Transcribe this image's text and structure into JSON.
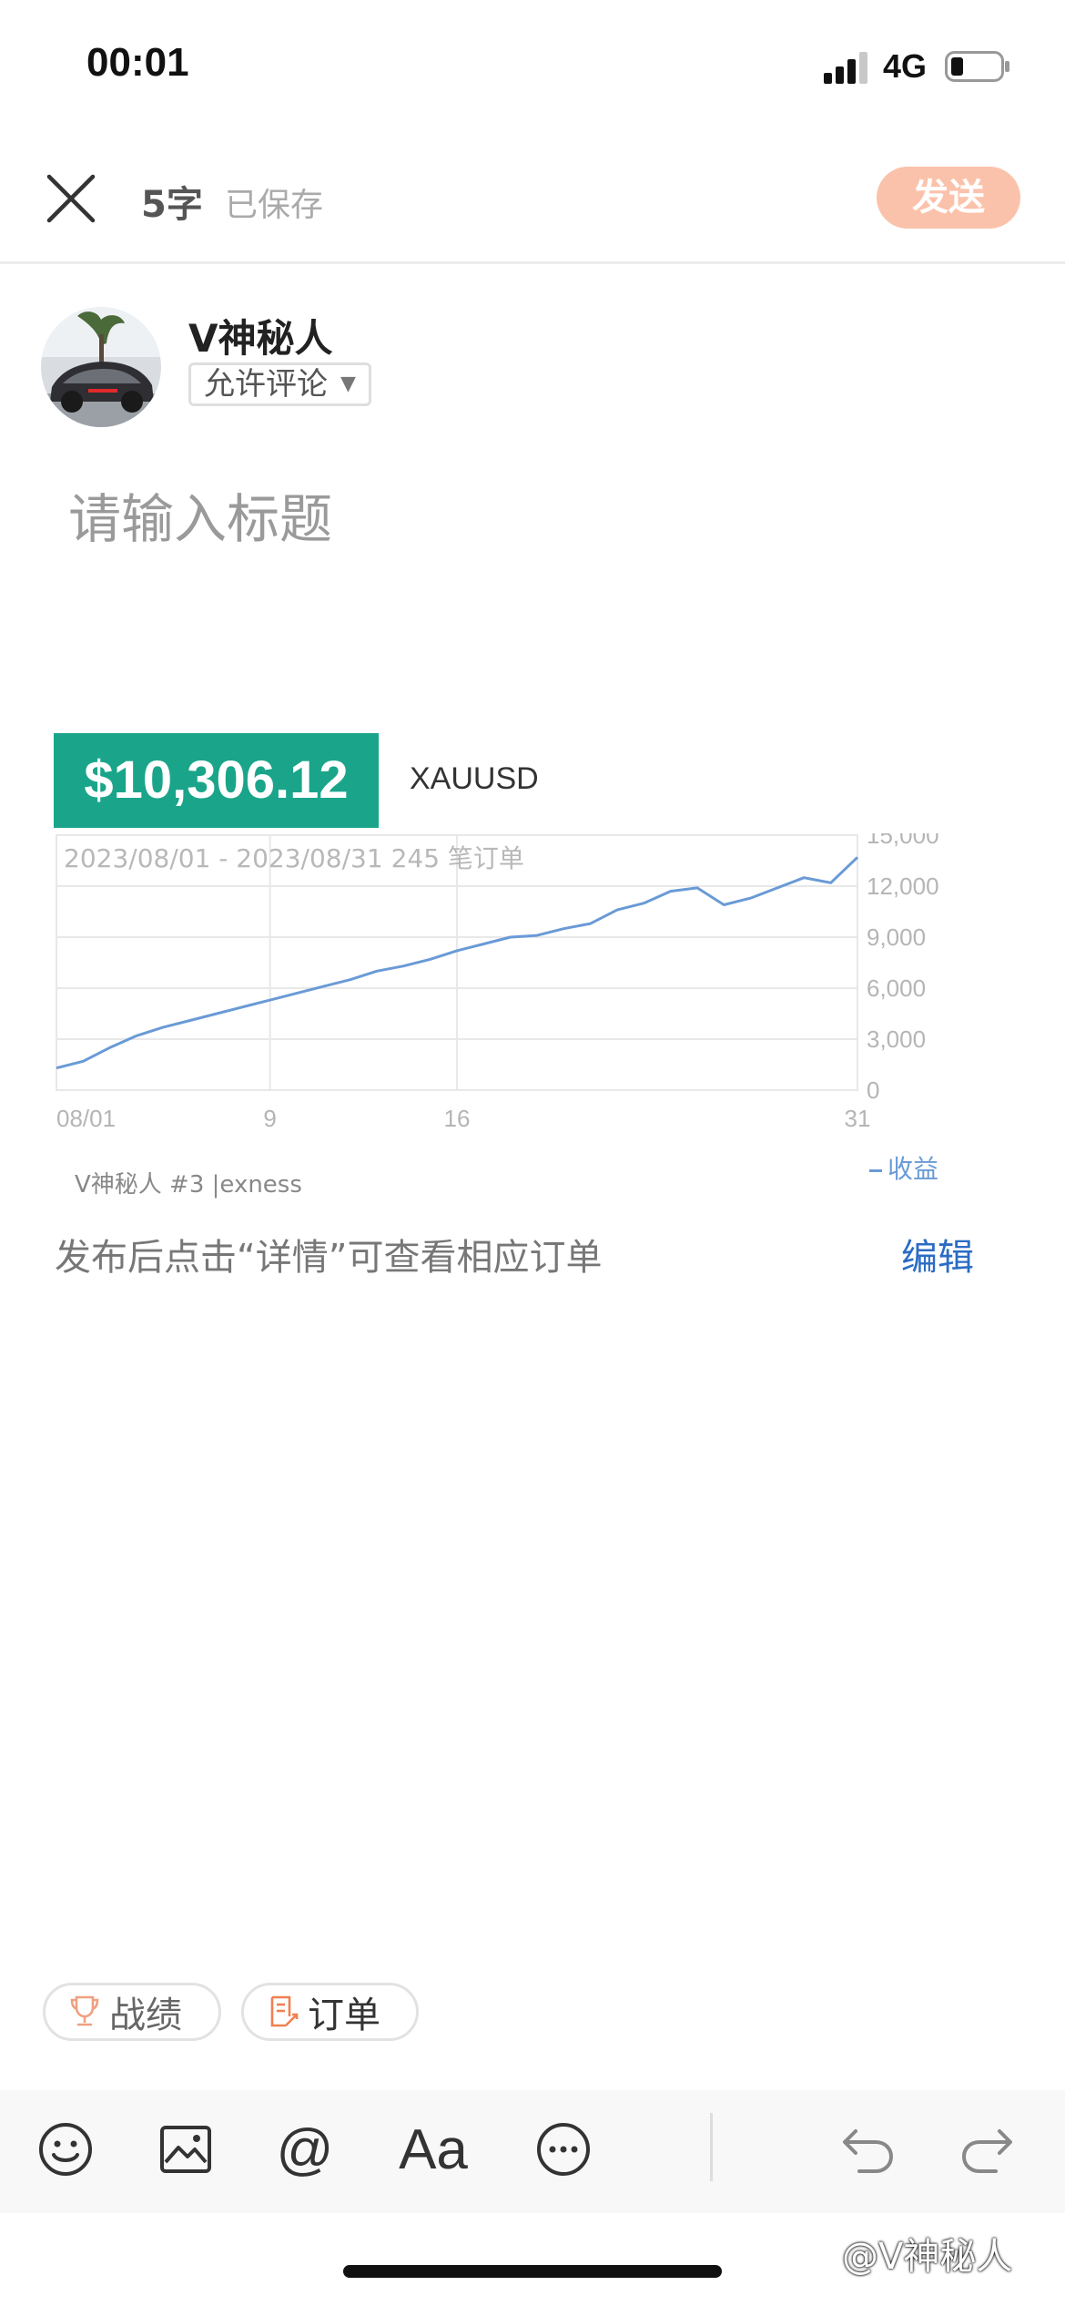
{
  "status_bar": {
    "time": "00:01",
    "network": "4G"
  },
  "header": {
    "word_count": "5字",
    "saved_status": "已保存",
    "send_label": "发送"
  },
  "author": {
    "name": "V神秘人",
    "comment_setting": "允许评论"
  },
  "title_input": {
    "placeholder": "请输入标题",
    "value": ""
  },
  "order_card": {
    "profit": "$10,306.12",
    "symbol": "XAUUSD",
    "footer": "V神秘人 #3 |exness",
    "hint": "发布后点击“详情”可查看相应订单",
    "edit_label": "编辑"
  },
  "chart_data": {
    "type": "line",
    "subtitle": "2023/08/01 - 2023/08/31 245 笔订单",
    "x_ticks": [
      "08/01",
      "9",
      "16",
      "31"
    ],
    "y_ticks": [
      "0",
      "3,000",
      "6,000",
      "9,000",
      "12,000",
      "15,000"
    ],
    "ylim": [
      0,
      15000
    ],
    "xlim": [
      1,
      31
    ],
    "grid": true,
    "legend": "bottom-right",
    "series": [
      {
        "name": "收益",
        "color": "#6a9ad6",
        "x": [
          1,
          2,
          3,
          4,
          5,
          6,
          7,
          8,
          9,
          10,
          11,
          12,
          13,
          14,
          15,
          16,
          17,
          18,
          19,
          20,
          21,
          22,
          23,
          24,
          25,
          26,
          27,
          28,
          29,
          30,
          31
        ],
        "y": [
          1300,
          1700,
          2500,
          3200,
          3700,
          4100,
          4500,
          4900,
          5300,
          5700,
          6100,
          6500,
          7000,
          7300,
          7700,
          8200,
          8600,
          9000,
          9100,
          9500,
          9800,
          10600,
          11000,
          11700,
          11900,
          10900,
          11300,
          11900,
          12500,
          12200,
          13700
        ]
      }
    ]
  },
  "tags": {
    "record_label": "战绩",
    "order_label": "订单"
  },
  "toolbar": {
    "icons": [
      "emoji-icon",
      "image-icon",
      "at-icon",
      "font-icon",
      "more-icon",
      "undo-icon",
      "redo-icon"
    ],
    "font_label": "Aa",
    "at_label": "@"
  },
  "watermark": "@V神秘人",
  "colors": {
    "profit_green": "#1aa58a",
    "send_button": "#fbc2ab",
    "chart_line": "#6a9ad6",
    "edit_link": "#2b6cc4"
  }
}
